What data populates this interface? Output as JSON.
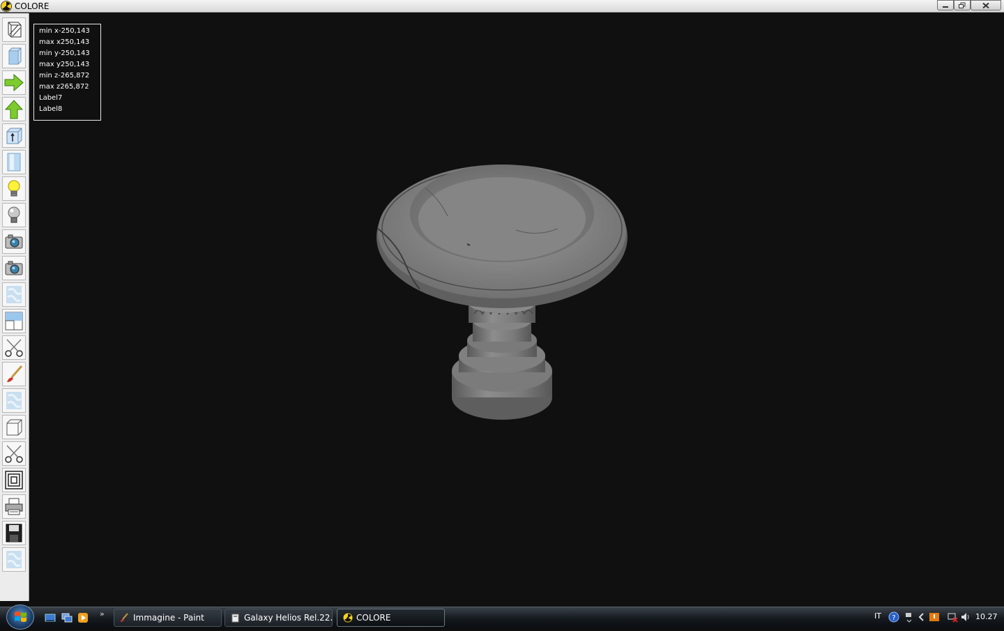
{
  "window": {
    "title": "COLORE"
  },
  "info": {
    "min_x": "min x-250,143",
    "max_x": "max x250,143",
    "min_y": "min y-250,143",
    "max_y": "max y250,143",
    "min_z": "min z-265,872",
    "max_z": "max z265,872",
    "label7": "Label7",
    "label8": "Label8"
  },
  "toolbar": [
    "wireframe-icon",
    "solid-view-icon",
    "arrow-right-icon",
    "arrow-up-icon",
    "box-info-icon",
    "cylinder-icon",
    "light-on-icon",
    "light-off-icon",
    "camera-icon",
    "camera-alt-icon",
    "texture-icon",
    "panel-icon",
    "scissors-icon",
    "brush-icon",
    "texture-alt-icon",
    "cube-icon",
    "scissors-alt-icon",
    "nested-squares-icon",
    "printer-icon",
    "floppy-disk-icon",
    "texture-extra-icon"
  ],
  "taskbar": {
    "quicklaunch": [
      "show-desktop-icon",
      "switch-windows-icon",
      "media-player-icon"
    ],
    "chevron": "»",
    "tasks": [
      {
        "label": "Immagine - Paint",
        "icon": "paint-icon"
      },
      {
        "label": "Galaxy Helios  Rel.22...",
        "icon": "document-icon"
      },
      {
        "label": "COLORE",
        "icon": "colore-app-icon"
      }
    ],
    "language": "IT",
    "clock": "10.27"
  },
  "colors": {
    "viewport_bg": "#101010",
    "marble": "#8c8c8c",
    "taskbar": "#151a1f"
  }
}
